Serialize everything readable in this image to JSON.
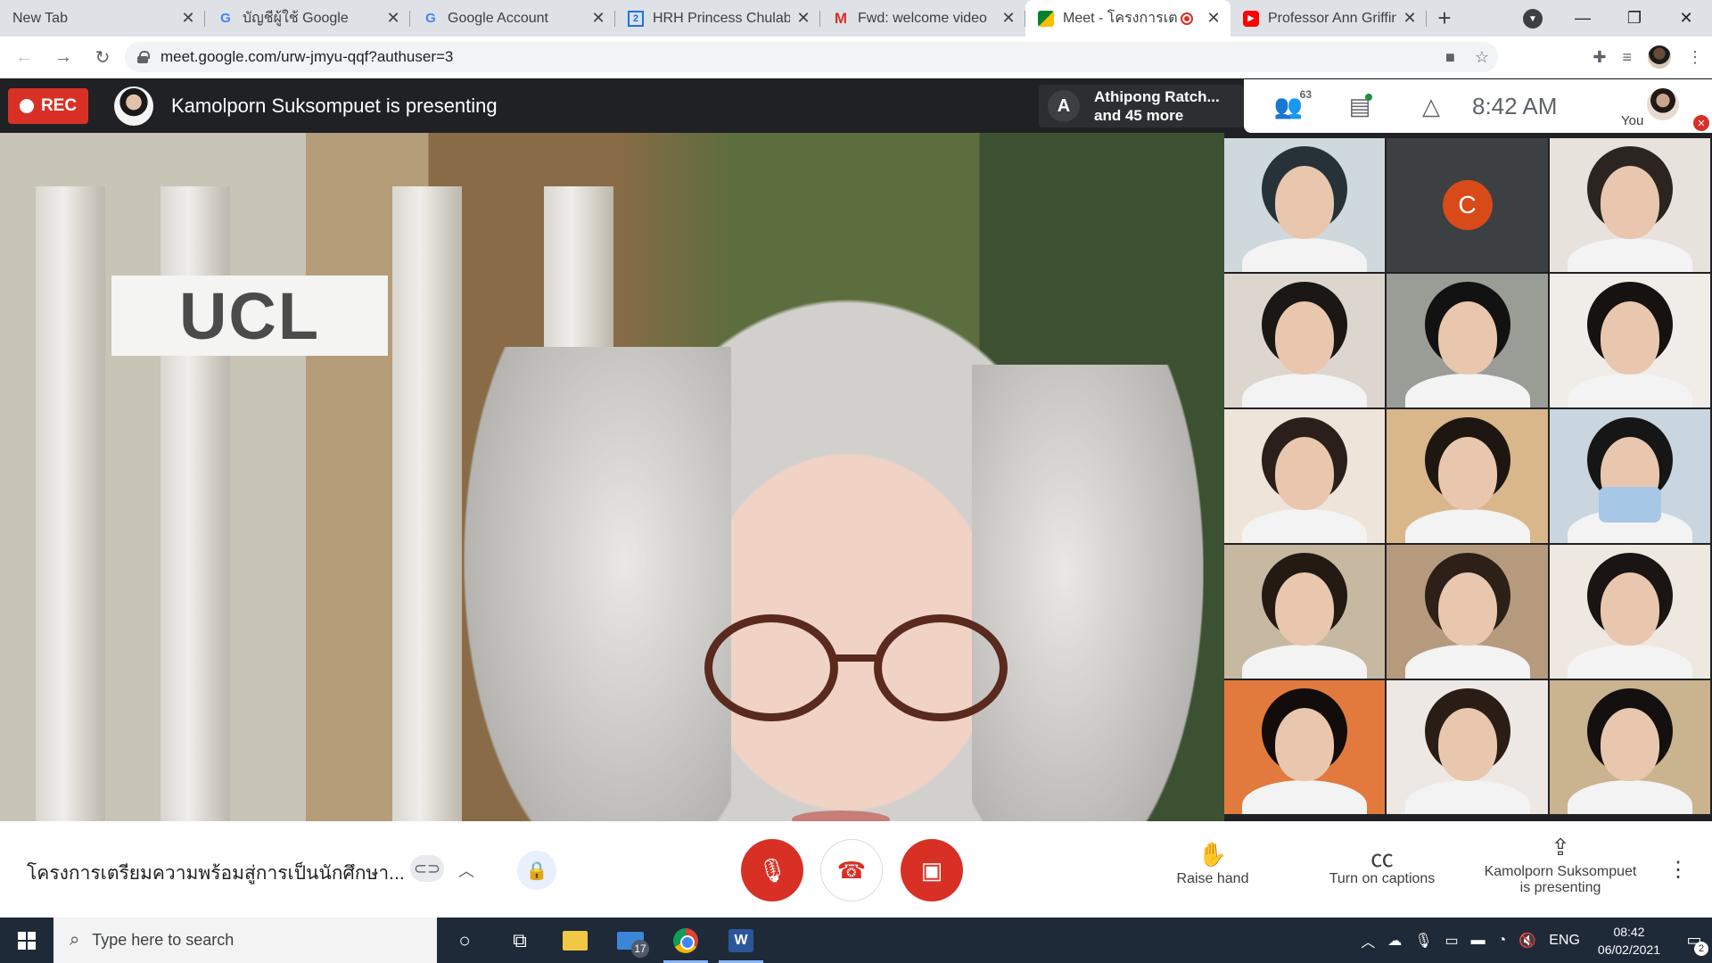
{
  "browser": {
    "tabs": [
      {
        "title": "New Tab",
        "favicon": "none"
      },
      {
        "title": "บัญชีผู้ใช้ Google",
        "favicon": "google-icon"
      },
      {
        "title": "Google Account",
        "favicon": "google-icon"
      },
      {
        "title": "HRH Princess Chulabh",
        "favicon": "calendar-icon"
      },
      {
        "title": "Fwd: welcome video",
        "favicon": "gmail-icon"
      },
      {
        "title": "Meet - โครงการเต",
        "favicon": "meet-icon",
        "active": true,
        "recording": true
      },
      {
        "title": "Professor Ann Griffin",
        "favicon": "youtube-icon"
      }
    ],
    "url": "meet.google.com/urw-jmyu-qqf?authuser=3"
  },
  "meet": {
    "rec_label": "REC",
    "presenter_banner": "Kamolporn Suksompuet is presenting",
    "participant_chip": {
      "initial": "A",
      "line1": "Athipong Ratch...",
      "line2": "and 45 more"
    },
    "people_count": "63",
    "time": "8:42 AM",
    "you_label": "You",
    "main_background_sign": "UCL",
    "grid_tiles": [
      {
        "type": "video"
      },
      {
        "type": "initial",
        "initial": "C"
      },
      {
        "type": "video"
      },
      {
        "type": "video"
      },
      {
        "type": "video"
      },
      {
        "type": "video"
      },
      {
        "type": "video"
      },
      {
        "type": "video"
      },
      {
        "type": "video"
      },
      {
        "type": "video"
      },
      {
        "type": "video"
      },
      {
        "type": "video"
      },
      {
        "type": "video"
      },
      {
        "type": "video"
      },
      {
        "type": "video"
      }
    ]
  },
  "controls": {
    "meeting_title": "โครงการเตรียมความพร้อมสู่การเป็นนักศึกษา...",
    "raise_hand": "Raise hand",
    "captions": "Turn on captions",
    "presenting_line1": "Kamolporn Suksompuet",
    "presenting_line2": "is presenting"
  },
  "taskbar": {
    "search_placeholder": "Type here to search",
    "mail_badge": "17",
    "language": "ENG",
    "time": "08:42",
    "date": "06/02/2021",
    "notification_count": "2"
  },
  "colors": {
    "accent_red": "#d93025",
    "meet_dark": "#202124",
    "taskbar": "#1f2a38"
  }
}
